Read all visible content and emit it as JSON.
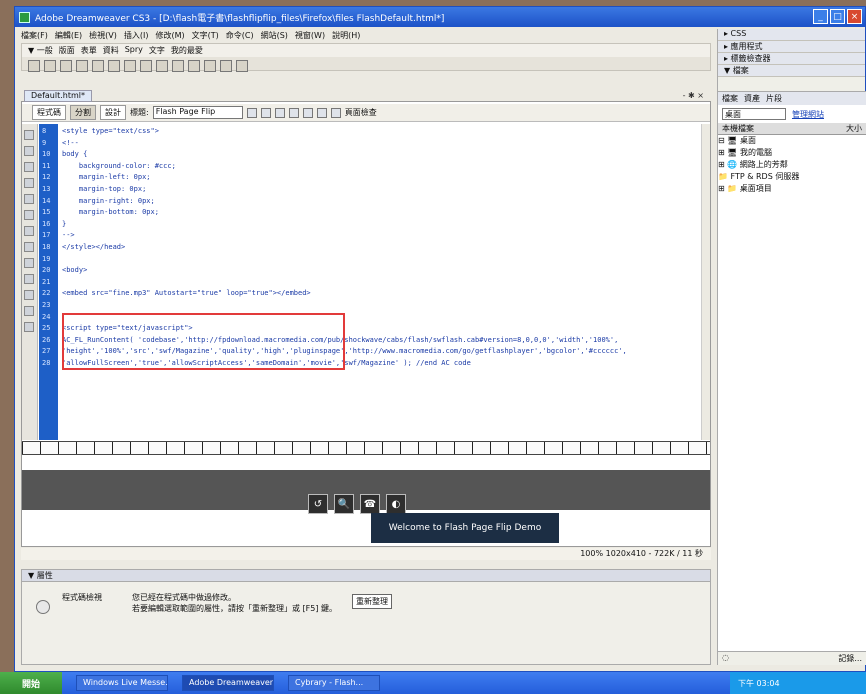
{
  "window": {
    "title": "Adobe Dreamweaver CS3 - [D:\\flash電子書\\flashflipflip_files\\Firefox\\files FlashDefault.html*]",
    "controls": [
      "_",
      "□",
      "×"
    ]
  },
  "menubar": [
    "檔案(F)",
    "編輯(E)",
    "檢視(V)",
    "插入(I)",
    "修改(M)",
    "文字(T)",
    "命令(C)",
    "網站(S)",
    "視窗(W)",
    "說明(H)"
  ],
  "insert_bar": {
    "tabs": [
      "▼ 一般",
      "版面",
      "表單",
      "資料",
      "Spry",
      "文字",
      "我的最愛"
    ]
  },
  "document": {
    "tab": "Default.html*",
    "controls": "- ✱ ×",
    "views": {
      "code": "程式碼",
      "split": "分割",
      "design": "設計"
    },
    "title_label": "標題:",
    "title_value": "Flash Page Flip",
    "validate_label": "頁面檢查"
  },
  "code": {
    "line_numbers": [
      "8",
      "9",
      "10",
      "11",
      "12",
      "13",
      "14",
      "15",
      "16",
      "17",
      "18",
      "19",
      "20",
      "21",
      "22",
      "23",
      "24",
      "25",
      "26",
      "27",
      "28"
    ],
    "lines": [
      "<style type=\"text/css\">",
      "<!--",
      "body {",
      "    background-color: #ccc;",
      "    margin-left: 0px;",
      "    margin-top: 0px;",
      "    margin-right: 0px;",
      "    margin-bottom: 0px;",
      "}",
      "-->",
      "</style></head>",
      "",
      "<body>",
      "",
      "<embed src=\"fine.mp3\" Autostart=\"true\" loop=\"true\"></embed>",
      "",
      "",
      "<script type=\"text/javascript\">",
      "AC_FL_RunContent( 'codebase','http://fpdownload.macromedia.com/pub/shockwave/cabs/flash/swflash.cab#version=8,0,0,0','width','100%',",
      "'height','100%','src','swf/Magazine','quality','high','pluginspage','http://www.macromedia.com/go/getflashplayer','bgcolor','#cccccc',",
      "'allowFullScreen','true','allowScriptAccess','sameDomain','movie','swf/Magazine' ); //end AC code"
    ]
  },
  "design": {
    "flash_buttons": [
      "↺",
      "🔍",
      "☎",
      "◐"
    ],
    "welcome_text": "Welcome to Flash Page Flip Demo"
  },
  "status_bar": "100% 1020x410 - 722K / 11 秒",
  "properties": {
    "header": "▼ 屬性",
    "label": "程式碼檢視",
    "text_line1": "您已經在程式碼中做過修改。",
    "text_line2": "若要編輯選取範圍的屬性，請按「重新整理」或 [F5] 鍵。",
    "refresh_button": "重新整理"
  },
  "right_panel": {
    "sections": [
      "▸ CSS",
      "▸ 應用程式",
      "▸ 標籤檢查器"
    ],
    "files_header": "▼ 檔案",
    "file_tabs": [
      "檔案",
      "資產",
      "片段"
    ],
    "site_select": "桌面",
    "manage_link": "管理網站",
    "columns": {
      "name": "本機檔案",
      "size": "大小"
    },
    "tree": [
      "⊟ 🖥 桌面",
      "   ⊞ 🖥 我的電腦",
      "   ⊞ 🌐 網路上的芳鄰",
      "      📁 FTP & RDS 伺服器",
      "   ⊞ 📁 桌面項目"
    ],
    "log_button": "記錄..."
  },
  "taskbar": {
    "start": "開始",
    "tasks": [
      "Windows Live Messe...",
      "Adobe Dreamweaver ...",
      "Cybrary - Flash..."
    ],
    "clock": "下午 03:04"
  }
}
